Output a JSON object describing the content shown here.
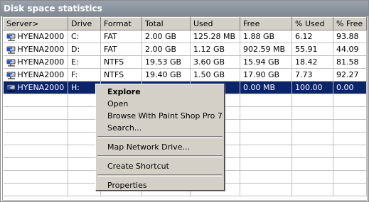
{
  "window": {
    "title": "Disk space statistics"
  },
  "table": {
    "columns": [
      "Server>",
      "Drive",
      "Format",
      "Total",
      "Used",
      "Free",
      "% Used",
      "% Free"
    ],
    "rows": [
      [
        "HYENA2000",
        "C:",
        "FAT",
        "2.00 GB",
        "125.28 MB",
        "1.88 GB",
        "6.12",
        "93.88"
      ],
      [
        "HYENA2000",
        "D:",
        "FAT",
        "2.00 GB",
        "1.12 GB",
        "902.59 MB",
        "55.91",
        "44.09"
      ],
      [
        "HYENA2000",
        "E:",
        "NTFS",
        "19.53 GB",
        "3.60 GB",
        "15.94 GB",
        "18.42",
        "81.58"
      ],
      [
        "HYENA2000",
        "F:",
        "NTFS",
        "19.40 GB",
        "1.50 GB",
        "17.90 GB",
        "7.73",
        "92.27"
      ],
      [
        "HYENA2000",
        "H:",
        "",
        "",
        "",
        "0.00 MB",
        "100.00",
        "0.00"
      ]
    ],
    "selected_row_index": 4,
    "row_icon": "network-drive-icon"
  },
  "context_menu": {
    "items": [
      {
        "label": "Explore",
        "default": true
      },
      {
        "label": "Open"
      },
      {
        "label": "Browse With Paint Shop Pro 7"
      },
      {
        "label": "Search..."
      },
      {
        "separator": true
      },
      {
        "label": "Map Network Drive..."
      },
      {
        "separator": true
      },
      {
        "label": "Create Shortcut"
      },
      {
        "separator": true
      },
      {
        "label": "Properties"
      }
    ]
  },
  "colors": {
    "selection": "#0a246a",
    "menu_bg": "#d4d0c8",
    "title_bg": "#8a929c"
  }
}
